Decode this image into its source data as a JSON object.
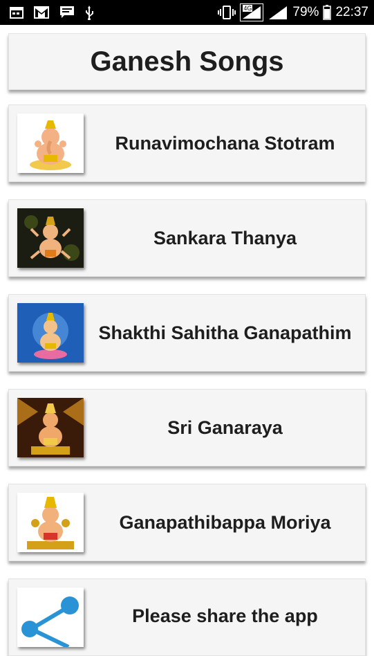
{
  "status_bar": {
    "battery_percent": "79%",
    "time": "22:37",
    "network_label": "4G",
    "icons": [
      "calendar-icon",
      "gmail-icon",
      "message-icon",
      "usb-icon",
      "vibrate-icon",
      "signal-icon",
      "signal-icon",
      "battery-icon"
    ]
  },
  "app": {
    "title": "Ganesh Songs"
  },
  "songs": [
    {
      "label": "Runavimochana Stotram",
      "thumb": "ganesha-white-bg"
    },
    {
      "label": "Sankara Thanya",
      "thumb": "ganesha-dark-bg"
    },
    {
      "label": "Shakthi Sahitha Ganapathim",
      "thumb": "ganesha-blue-bg"
    },
    {
      "label": "Sri Ganaraya",
      "thumb": "ganesha-temple-bg"
    },
    {
      "label": "Ganapathibappa Moriya",
      "thumb": "ganesha-gold-bg"
    }
  ],
  "share": {
    "label": "Please share the app",
    "icon": "share-icon"
  },
  "colors": {
    "card_bg": "#f5f5f5",
    "text": "#1e1e1e",
    "status_bar": "#000000",
    "share_icon": "#2a93d5"
  }
}
